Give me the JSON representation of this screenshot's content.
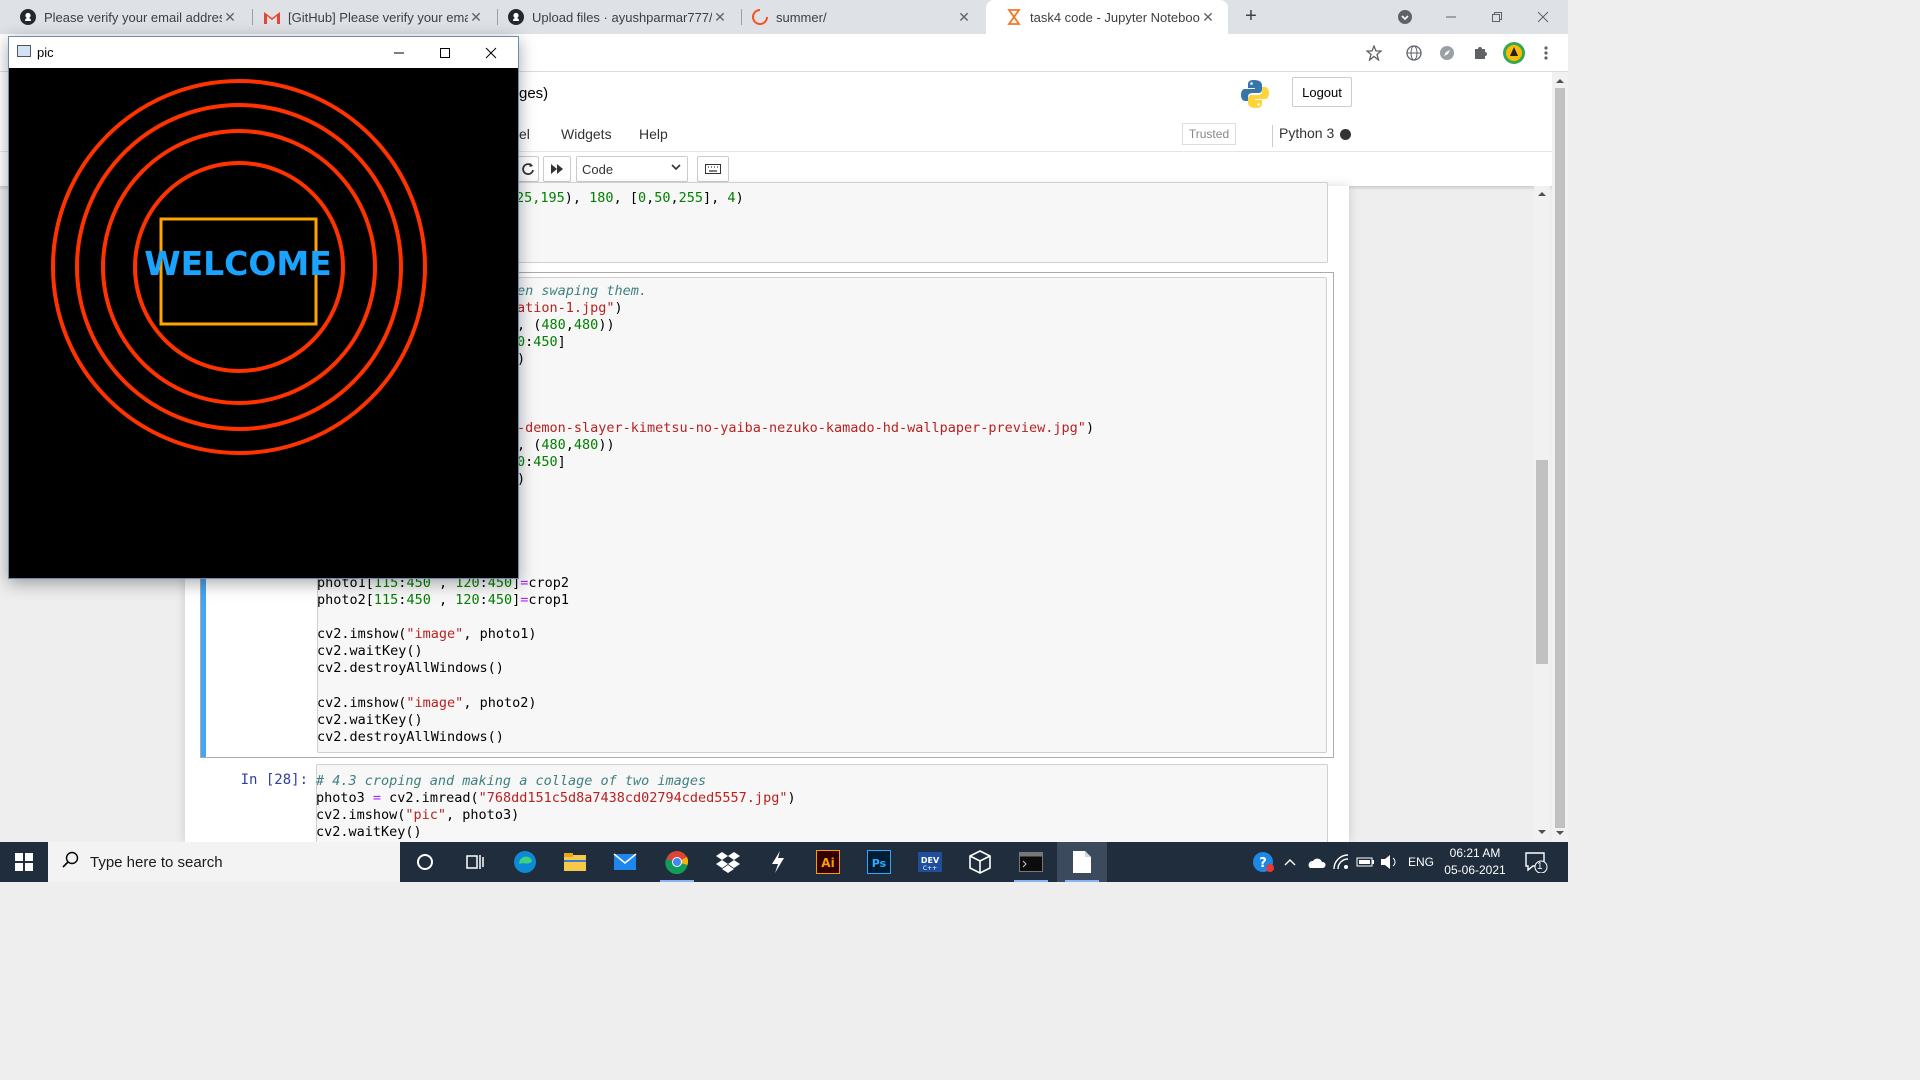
{
  "browser": {
    "tabs": [
      {
        "label": "Please verify your email address",
        "icon": "github-icon"
      },
      {
        "label": "[GitHub] Please verify your email",
        "icon": "gmail-icon"
      },
      {
        "label": "Upload files · ayushparmar777/ir",
        "icon": "github-icon"
      },
      {
        "label": "summer/",
        "icon": "loading-icon"
      },
      {
        "label": "task4 code - Jupyter Notebook",
        "icon": "jupyter-icon"
      }
    ],
    "close_glyph": "✕",
    "newtab_glyph": "+"
  },
  "jupyter": {
    "title_fragment": "ges)",
    "logout_label": "Logout",
    "menu": [
      "el",
      "Widgets",
      "Help"
    ],
    "trusted_label": "Trusted",
    "kernel_label": "Python 3",
    "celltype_value": "Code"
  },
  "cells": [
    {
      "code_lines": [
        "25,195), 180, [0,50,255], 4)"
      ]
    },
    {
      "lines_top": [
        "en swaping them.",
        "ation-1.jpg\")",
        ", (480,480))",
        "0:450]",
        ")",
        "",
        "",
        "",
        "-demon-slayer-kimetsu-no-yaiba-nezuko-kamado-hd-wallpaper-preview.jpg\")",
        ", (480,480))",
        "0:450]",
        ")"
      ],
      "lines_bottom": [
        "photo1[115:450 , 120:450]=crop2",
        "photo2[115:450 , 120:450]=crop1",
        "",
        "cv2.imshow(\"image\", photo1)",
        "cv2.waitKey()",
        "cv2.destroyAllWindows()",
        "",
        "cv2.imshow(\"image\", photo2)",
        "cv2.waitKey()",
        "cv2.destroyAllWindows()"
      ]
    },
    {
      "prompt": "In [28]:",
      "code_lines": [
        "# 4.3 croping and making a collage of two images",
        "photo3 = cv2.imread(\"768dd151c5d8a7438cd02794cded5557.jpg\")",
        "cv2.imshow(\"pic\", photo3)",
        "cv2.waitKey()"
      ]
    }
  ],
  "cv_window": {
    "title": "pic",
    "welcome_text": "WELCOME",
    "ring_color": "#ff3300",
    "rect_color": "#ffa500",
    "text_color": "#1aa3ff"
  },
  "taskbar": {
    "search_placeholder": "Type here to search",
    "lang": "ENG",
    "time": "06:21 AM",
    "date": "05-06-2021",
    "notification_count": "1",
    "apps": [
      "task-view-icon",
      "edge-icon",
      "file-explorer-icon",
      "mail-icon",
      "chrome-icon",
      "dropbox-icon",
      "vscode-icon",
      "illustrator-icon",
      "photoshop-icon",
      "devcpp-icon",
      "virtualbox-icon",
      "terminal-icon",
      "notepad-icon"
    ]
  }
}
